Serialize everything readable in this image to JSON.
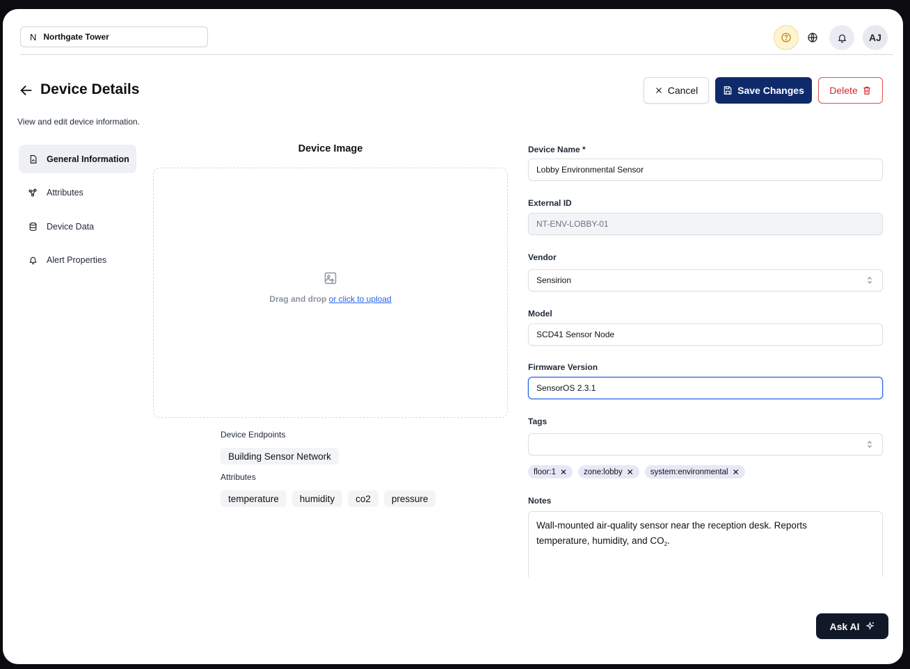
{
  "org": {
    "initial": "N",
    "name": "Northgate Tower"
  },
  "topbar": {
    "avatar_initials": "AJ",
    "icons": [
      "help-icon",
      "globe-icon",
      "bell-icon"
    ]
  },
  "header": {
    "title": "Device Details",
    "subtitle": "View and edit device information.",
    "cancel_label": "Cancel",
    "save_label": "Save Changes",
    "delete_label": "Delete"
  },
  "nav": {
    "items": [
      {
        "label": "General Information",
        "icon": "document-chart-icon",
        "active": true
      },
      {
        "label": "Attributes",
        "icon": "nodes-icon",
        "active": false
      },
      {
        "label": "Device Data",
        "icon": "database-icon",
        "active": false
      },
      {
        "label": "Alert Properties",
        "icon": "bell-icon",
        "active": false
      }
    ]
  },
  "image": {
    "title": "Device Image",
    "drop_text": "Drag and drop",
    "upload_link": "or click to upload"
  },
  "endpoints": {
    "label": "Device Endpoints",
    "items": [
      "Building Sensor Network"
    ]
  },
  "attributes": {
    "label": "Attributes",
    "items": [
      "temperature",
      "humidity",
      "co2",
      "pressure"
    ]
  },
  "form": {
    "device_name": {
      "label": "Device Name *",
      "value": "Lobby Environmental Sensor"
    },
    "external_id": {
      "label": "External ID",
      "value": "NT-ENV-LOBBY-01"
    },
    "vendor": {
      "label": "Vendor",
      "value": "Sensirion"
    },
    "model": {
      "label": "Model",
      "value": "SCD41 Sensor Node"
    },
    "firmware": {
      "label": "Firmware Version",
      "value": "SensorOS 2.3.1"
    },
    "tags": {
      "label": "Tags",
      "value": "",
      "items": [
        "floor:1",
        "zone:lobby",
        "system:environmental"
      ]
    },
    "notes": {
      "label": "Notes",
      "value_line1": "Wall-mounted air-quality sensor near the reception desk. Reports",
      "value_line2": "temperature, humidity, and CO",
      "value_sub": "2",
      "value_end": "."
    }
  },
  "ask_ai": {
    "label": "Ask AI"
  },
  "colors": {
    "primary": "#0f2a6b",
    "danger": "#dc2626",
    "link": "#2563eb",
    "help": "#fdf4d6"
  }
}
